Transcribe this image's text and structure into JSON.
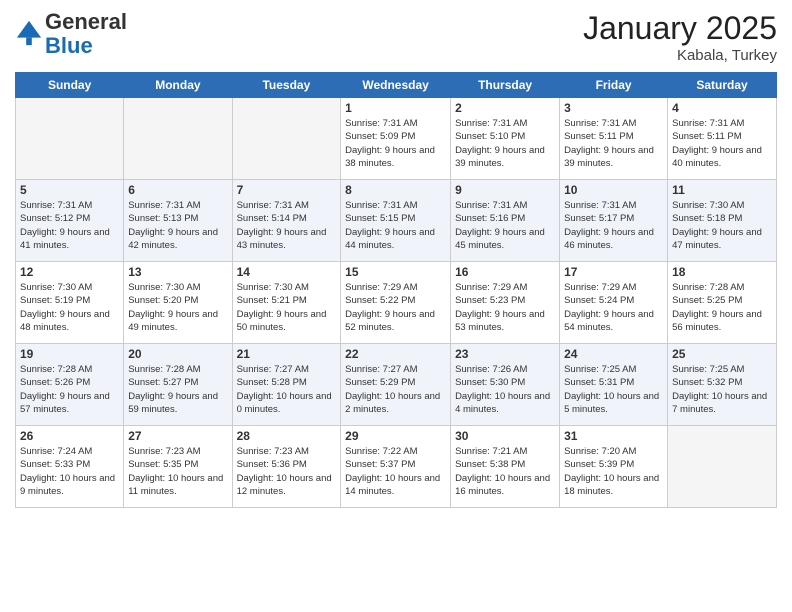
{
  "header": {
    "logo_general": "General",
    "logo_blue": "Blue",
    "month_title": "January 2025",
    "location": "Kabala, Turkey"
  },
  "days_of_week": [
    "Sunday",
    "Monday",
    "Tuesday",
    "Wednesday",
    "Thursday",
    "Friday",
    "Saturday"
  ],
  "weeks": [
    [
      {
        "day": "",
        "empty": true
      },
      {
        "day": "",
        "empty": true
      },
      {
        "day": "",
        "empty": true
      },
      {
        "day": "1",
        "sunrise": "7:31 AM",
        "sunset": "5:09 PM",
        "daylight": "9 hours and 38 minutes."
      },
      {
        "day": "2",
        "sunrise": "7:31 AM",
        "sunset": "5:10 PM",
        "daylight": "9 hours and 39 minutes."
      },
      {
        "day": "3",
        "sunrise": "7:31 AM",
        "sunset": "5:11 PM",
        "daylight": "9 hours and 39 minutes."
      },
      {
        "day": "4",
        "sunrise": "7:31 AM",
        "sunset": "5:11 PM",
        "daylight": "9 hours and 40 minutes."
      }
    ],
    [
      {
        "day": "5",
        "sunrise": "7:31 AM",
        "sunset": "5:12 PM",
        "daylight": "9 hours and 41 minutes."
      },
      {
        "day": "6",
        "sunrise": "7:31 AM",
        "sunset": "5:13 PM",
        "daylight": "9 hours and 42 minutes."
      },
      {
        "day": "7",
        "sunrise": "7:31 AM",
        "sunset": "5:14 PM",
        "daylight": "9 hours and 43 minutes."
      },
      {
        "day": "8",
        "sunrise": "7:31 AM",
        "sunset": "5:15 PM",
        "daylight": "9 hours and 44 minutes."
      },
      {
        "day": "9",
        "sunrise": "7:31 AM",
        "sunset": "5:16 PM",
        "daylight": "9 hours and 45 minutes."
      },
      {
        "day": "10",
        "sunrise": "7:31 AM",
        "sunset": "5:17 PM",
        "daylight": "9 hours and 46 minutes."
      },
      {
        "day": "11",
        "sunrise": "7:30 AM",
        "sunset": "5:18 PM",
        "daylight": "9 hours and 47 minutes."
      }
    ],
    [
      {
        "day": "12",
        "sunrise": "7:30 AM",
        "sunset": "5:19 PM",
        "daylight": "9 hours and 48 minutes."
      },
      {
        "day": "13",
        "sunrise": "7:30 AM",
        "sunset": "5:20 PM",
        "daylight": "9 hours and 49 minutes."
      },
      {
        "day": "14",
        "sunrise": "7:30 AM",
        "sunset": "5:21 PM",
        "daylight": "9 hours and 50 minutes."
      },
      {
        "day": "15",
        "sunrise": "7:29 AM",
        "sunset": "5:22 PM",
        "daylight": "9 hours and 52 minutes."
      },
      {
        "day": "16",
        "sunrise": "7:29 AM",
        "sunset": "5:23 PM",
        "daylight": "9 hours and 53 minutes."
      },
      {
        "day": "17",
        "sunrise": "7:29 AM",
        "sunset": "5:24 PM",
        "daylight": "9 hours and 54 minutes."
      },
      {
        "day": "18",
        "sunrise": "7:28 AM",
        "sunset": "5:25 PM",
        "daylight": "9 hours and 56 minutes."
      }
    ],
    [
      {
        "day": "19",
        "sunrise": "7:28 AM",
        "sunset": "5:26 PM",
        "daylight": "9 hours and 57 minutes."
      },
      {
        "day": "20",
        "sunrise": "7:28 AM",
        "sunset": "5:27 PM",
        "daylight": "9 hours and 59 minutes."
      },
      {
        "day": "21",
        "sunrise": "7:27 AM",
        "sunset": "5:28 PM",
        "daylight": "10 hours and 0 minutes."
      },
      {
        "day": "22",
        "sunrise": "7:27 AM",
        "sunset": "5:29 PM",
        "daylight": "10 hours and 2 minutes."
      },
      {
        "day": "23",
        "sunrise": "7:26 AM",
        "sunset": "5:30 PM",
        "daylight": "10 hours and 4 minutes."
      },
      {
        "day": "24",
        "sunrise": "7:25 AM",
        "sunset": "5:31 PM",
        "daylight": "10 hours and 5 minutes."
      },
      {
        "day": "25",
        "sunrise": "7:25 AM",
        "sunset": "5:32 PM",
        "daylight": "10 hours and 7 minutes."
      }
    ],
    [
      {
        "day": "26",
        "sunrise": "7:24 AM",
        "sunset": "5:33 PM",
        "daylight": "10 hours and 9 minutes."
      },
      {
        "day": "27",
        "sunrise": "7:23 AM",
        "sunset": "5:35 PM",
        "daylight": "10 hours and 11 minutes."
      },
      {
        "day": "28",
        "sunrise": "7:23 AM",
        "sunset": "5:36 PM",
        "daylight": "10 hours and 12 minutes."
      },
      {
        "day": "29",
        "sunrise": "7:22 AM",
        "sunset": "5:37 PM",
        "daylight": "10 hours and 14 minutes."
      },
      {
        "day": "30",
        "sunrise": "7:21 AM",
        "sunset": "5:38 PM",
        "daylight": "10 hours and 16 minutes."
      },
      {
        "day": "31",
        "sunrise": "7:20 AM",
        "sunset": "5:39 PM",
        "daylight": "10 hours and 18 minutes."
      },
      {
        "day": "",
        "empty": true
      }
    ]
  ]
}
